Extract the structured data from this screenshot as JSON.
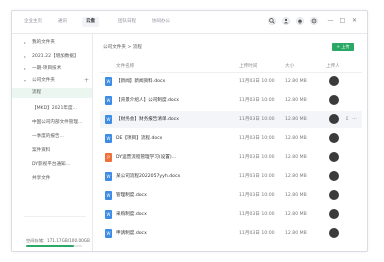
{
  "tabs": [
    "企业主页",
    "通讯",
    "云盘",
    "团队日程",
    "协同办公"
  ],
  "active_tab": 2,
  "window_controls": {
    "search_icon": "search-icon",
    "user_icon": "user-icon",
    "bell_icon": "bell-icon",
    "settings_icon": "gear-icon",
    "minimize": "—",
    "maximize": "□",
    "close": "✕"
  },
  "sidebar": {
    "items": [
      {
        "label": "我的文件夹",
        "arrow": "▸",
        "selected": false
      },
      {
        "label": "2021.22【增加数据】",
        "arrow": "▸",
        "selected": false
      },
      {
        "label": "一期-项目技术",
        "arrow": "▸",
        "selected": false
      },
      {
        "label": "公司文件夹",
        "arrow": "▾",
        "selected": false,
        "plus": "+"
      },
      {
        "label": "流程",
        "arrow": "",
        "selected": true
      },
      {
        "label": "【MKD】2021年度...",
        "arrow": "",
        "selected": false
      },
      {
        "label": "中国公司内部文件管理...",
        "arrow": "",
        "selected": false
      },
      {
        "label": "一季度的报告...",
        "arrow": "",
        "selected": false
      },
      {
        "label": "案件资料",
        "arrow": "",
        "selected": false
      },
      {
        "label": "DY影视平台通知...",
        "arrow": "",
        "selected": false
      },
      {
        "label": "共享文件",
        "arrow": "",
        "selected": false
      }
    ],
    "storage_label": "空间存储：171.17GB/100.00GB",
    "storage_used_fraction": 0.85
  },
  "main": {
    "breadcrumb": "公司文件夹 > 流程",
    "upload_label": "+ 上传",
    "columns": {
      "name": "文件名称",
      "date": "上传时间",
      "size": "大小",
      "uploader": "上传人"
    },
    "rows": [
      {
        "name": "【新闻】新闻资料.docx",
        "type": "doc",
        "date": "11月03日 10:00",
        "size": "12.80 MB",
        "highlight": false
      },
      {
        "name": "【背景介绍人】公司制度.docx",
        "type": "doc",
        "date": "11月03日 10:00",
        "size": "12.80 MB",
        "highlight": false
      },
      {
        "name": "【财务会】财务报告清单.docx",
        "type": "doc",
        "date": "11月03日 10:00",
        "size": "12.80 MB",
        "highlight": true
      },
      {
        "name": "DE【项目】流程.docx",
        "type": "doc",
        "date": "11月03日 10:00",
        "size": "12.80 MB",
        "highlight": false
      },
      {
        "name": "DY运营流程管理学习(设置)...",
        "type": "ppt",
        "date": "11月03日 10:00",
        "size": "12.80 MB",
        "highlight": false
      },
      {
        "name": "某公司流程2022057yyh.docx",
        "type": "doc",
        "date": "11月03日 10:00",
        "size": "12.80 MB",
        "highlight": false
      },
      {
        "name": "管理制度.docx",
        "type": "doc",
        "date": "11月03日 10:00",
        "size": "12.80 MB",
        "highlight": false
      },
      {
        "name": "采购制度.docx",
        "type": "doc",
        "date": "11月03日 10:00",
        "size": "12.80 MB",
        "highlight": false
      },
      {
        "name": "申请制度.docx",
        "type": "doc",
        "date": "11月03日 10:00",
        "size": "12.80 MB",
        "highlight": false
      }
    ],
    "row_actions": {
      "download_icon": "download-icon",
      "more_icon": "more-icon",
      "download": "⇩",
      "more": "⋯"
    }
  },
  "colors": {
    "accent": "#2aa866",
    "doc_icon": "#3d8ce6",
    "ppt_icon": "#f0703c"
  }
}
